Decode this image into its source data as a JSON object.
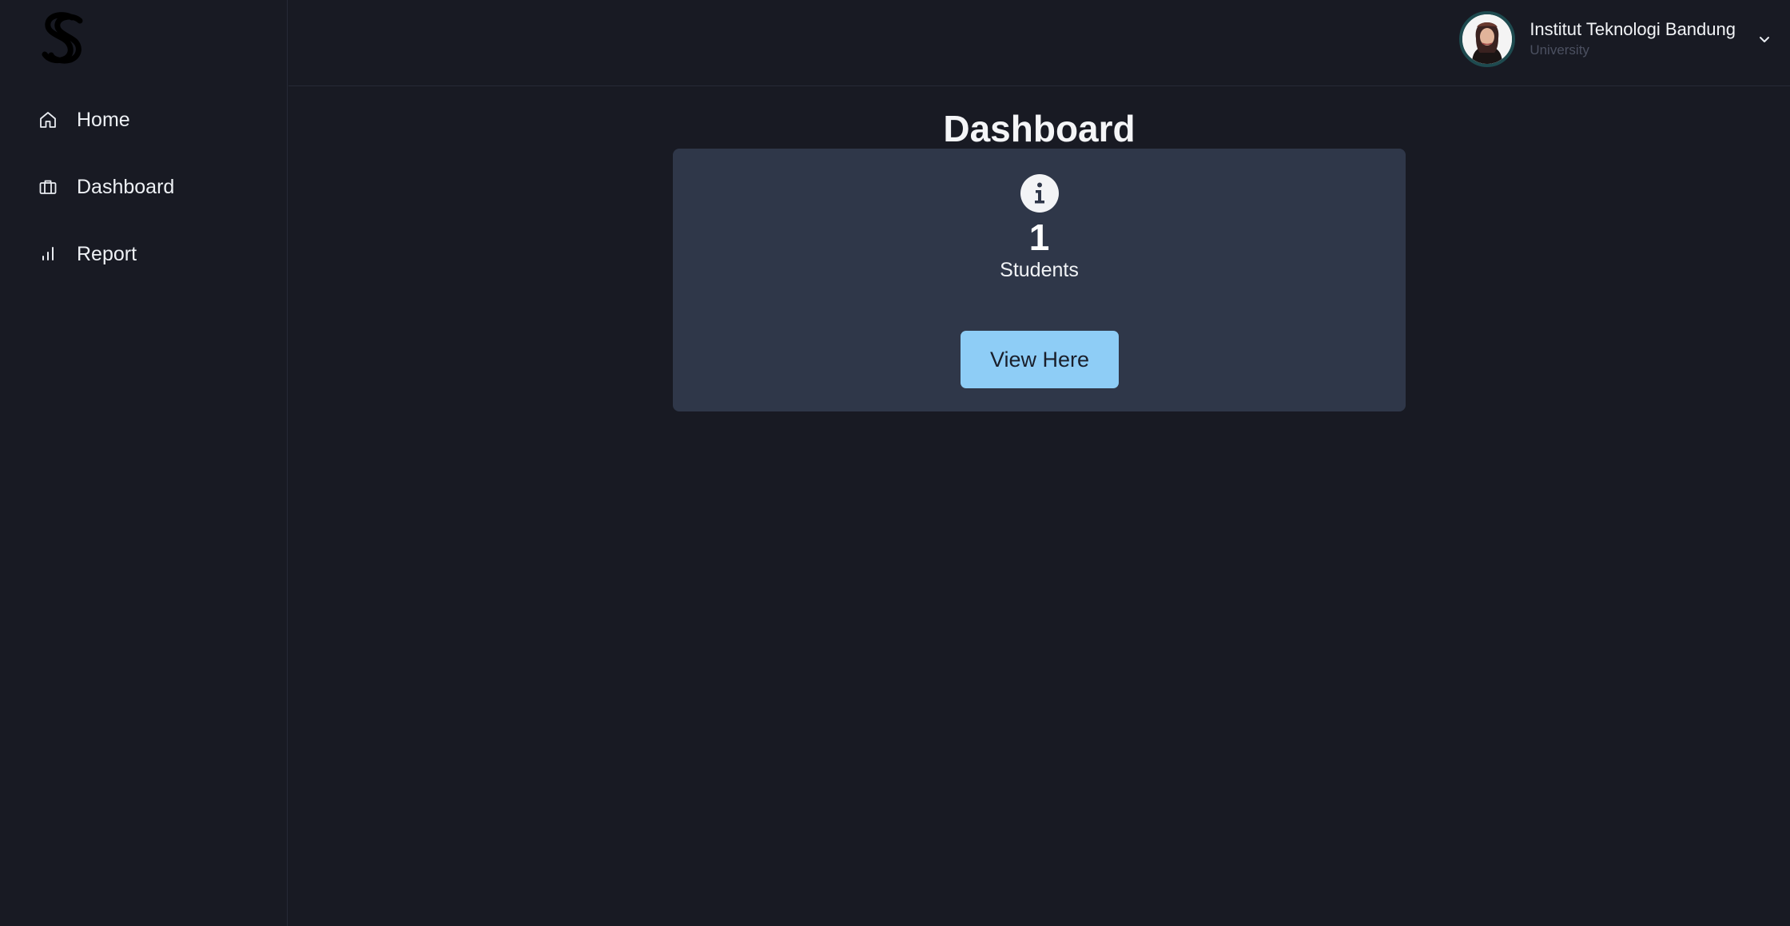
{
  "sidebar": {
    "logo_icon": "s-logo-icon",
    "items": [
      {
        "label": "Home",
        "icon": "home-icon"
      },
      {
        "label": "Dashboard",
        "icon": "briefcase-icon"
      },
      {
        "label": "Report",
        "icon": "bar-chart-icon"
      }
    ]
  },
  "header": {
    "profile": {
      "name": "Institut Teknologi Bandung",
      "role": "University",
      "dropdown_icon": "chevron-down-icon"
    }
  },
  "main": {
    "title": "Dashboard",
    "card": {
      "icon": "info-icon",
      "value": "1",
      "label": "Students",
      "button_label": "View Here"
    }
  },
  "colors": {
    "background": "#181a23",
    "card": "#2f3749",
    "button": "#8ecdf6",
    "avatar_ring": "#1e4a4f"
  }
}
